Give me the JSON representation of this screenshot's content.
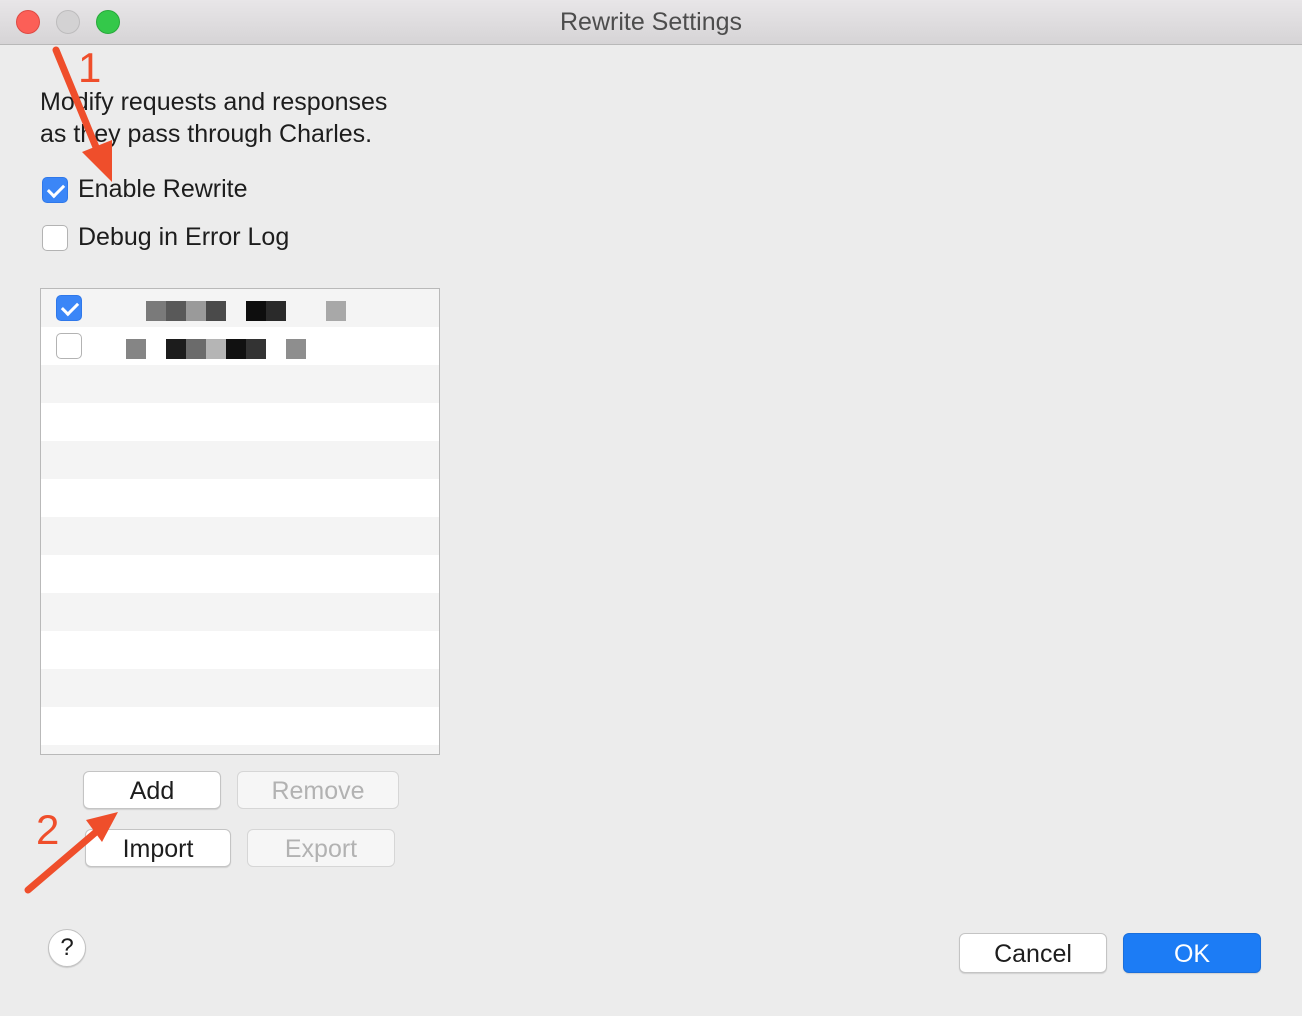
{
  "window": {
    "title": "Rewrite Settings"
  },
  "description": {
    "line1": "Modify requests and responses",
    "line2": "as they pass through Charles."
  },
  "options": {
    "enable_rewrite": {
      "label": "Enable Rewrite",
      "checked": true
    },
    "debug_error_log": {
      "label": "Debug in Error Log",
      "checked": false
    }
  },
  "rule_list": {
    "items": [
      {
        "checked": true
      },
      {
        "checked": false
      }
    ]
  },
  "buttons": {
    "add": "Add",
    "remove": "Remove",
    "import": "Import",
    "export": "Export",
    "help": "?",
    "cancel": "Cancel",
    "ok": "OK"
  },
  "annotations": {
    "marker1": "1",
    "marker2": "2"
  },
  "colors": {
    "accent_blue": "#1c7cf5",
    "annotation_orange": "#ef4e2b"
  }
}
